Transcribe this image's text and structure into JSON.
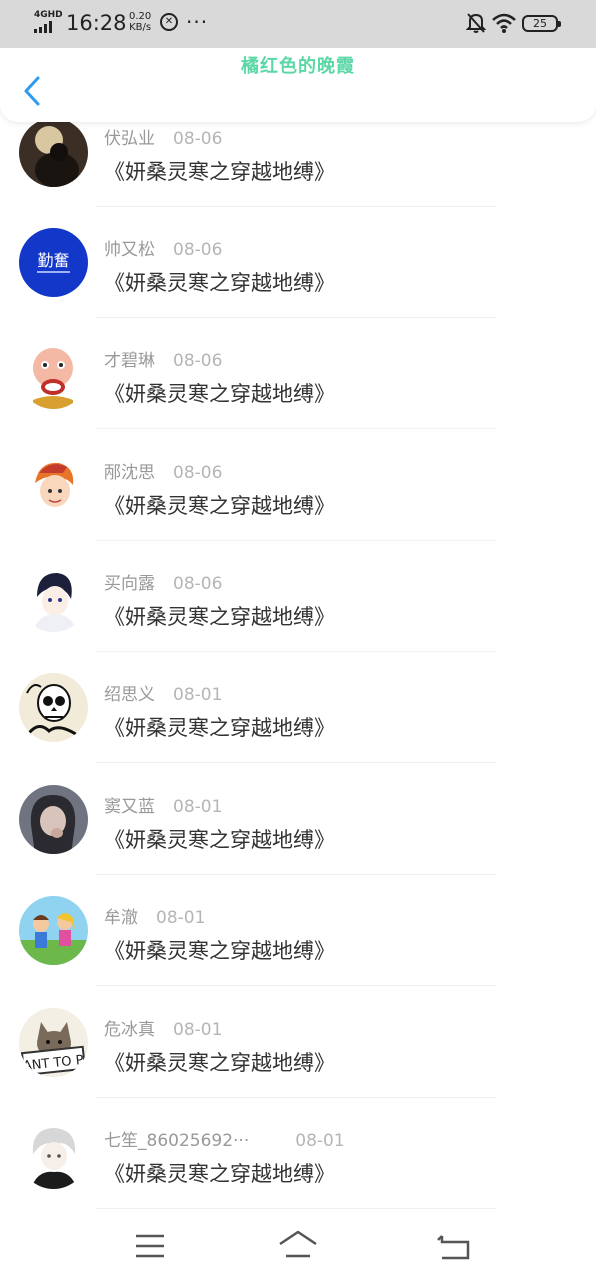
{
  "status_bar": {
    "network": "4GHD",
    "time": "16:28",
    "speed_value": "0.20",
    "speed_unit": "KB/s",
    "more": "···",
    "battery": "25"
  },
  "header": {
    "title": "橘红色的晚霞"
  },
  "comments": [
    {
      "name": "伏弘业",
      "date": "08-06",
      "text": "《妍桑灵寒之穿越地缚》",
      "avatar": "dark-photo"
    },
    {
      "name": "帅又松",
      "date": "08-06",
      "text": "《妍桑灵寒之穿越地缚》",
      "avatar": "blue-logo",
      "avatar_text": "勤奮"
    },
    {
      "name": "才碧琳",
      "date": "08-06",
      "text": "《妍桑灵寒之穿越地缚》",
      "avatar": "cartoon-monk"
    },
    {
      "name": "邴沈思",
      "date": "08-06",
      "text": "《妍桑灵寒之穿越地缚》",
      "avatar": "anime-orange-hair"
    },
    {
      "name": "买向露",
      "date": "08-06",
      "text": "《妍桑灵寒之穿越地缚》",
      "avatar": "anime-dark-hair"
    },
    {
      "name": "绍思义",
      "date": "08-01",
      "text": "《妍桑灵寒之穿越地缚》",
      "avatar": "skull-sketch"
    },
    {
      "name": "窦又蓝",
      "date": "08-01",
      "text": "《妍桑灵寒之穿越地缚》",
      "avatar": "girl-photo"
    },
    {
      "name": "牟澈",
      "date": "08-01",
      "text": "《妍桑灵寒之穿越地缚》",
      "avatar": "cartoon-kids"
    },
    {
      "name": "危冰真",
      "date": "08-01",
      "text": "《妍桑灵寒之穿越地缚》",
      "avatar": "cat-sign",
      "avatar_text": "ANT TO P"
    },
    {
      "name": "七笙_86025692···",
      "date": "08-01",
      "text": "《妍桑灵寒之穿越地缚》",
      "avatar": "anime-white-hair"
    }
  ],
  "colors": {
    "title": "#5bd8a5",
    "back_icon": "#2e9bf0",
    "status_bar": "#d9d9d9"
  },
  "nav": {
    "icons": [
      "menu-icon",
      "home-icon",
      "back-icon"
    ]
  }
}
